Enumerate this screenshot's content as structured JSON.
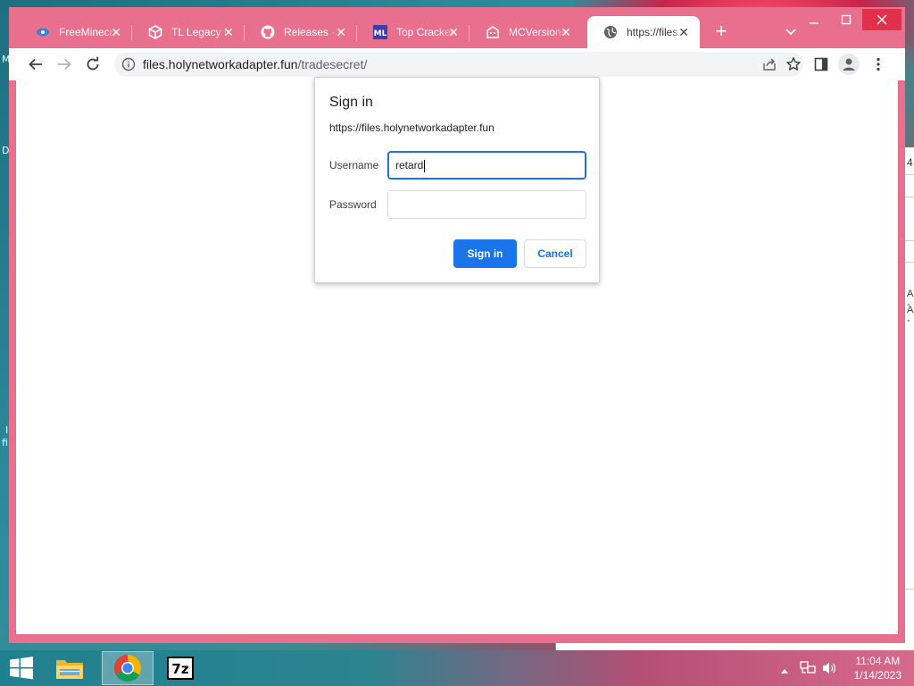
{
  "browser": {
    "tabs": [
      {
        "title": "FreeMinecraft",
        "icon": "freeminecraft-favicon-icon"
      },
      {
        "title": "TL Legacy for",
        "icon": "cube-favicon-icon"
      },
      {
        "title": "Releases · p",
        "icon": "github-favicon-icon"
      },
      {
        "title": "Top Cracked",
        "icon": "ml-favicon-icon"
      },
      {
        "title": "MCVersions",
        "icon": "mcversions-favicon-icon"
      },
      {
        "title": "https://files.",
        "icon": "globe-favicon-icon"
      }
    ],
    "active_tab": 5,
    "url_host": "files.holynetworkadapter.fun",
    "url_path": "/tradesecret/"
  },
  "dialog": {
    "title": "Sign in",
    "origin": "https://files.holynetworkadapter.fun",
    "username_label": "Username",
    "username_value": "retard",
    "password_label": "Password",
    "password_value": "",
    "signin_label": "Sign in",
    "cancel_label": "Cancel"
  },
  "desktop": {
    "left_glyphs": [
      "M",
      "D",
      "I",
      "fi"
    ],
    "right_glyphs": [
      "4",
      "A -",
      "A -"
    ]
  },
  "taskbar": {
    "time": "11:04 AM",
    "date": "1/14/2023",
    "apps": [
      "file-explorer-icon",
      "chrome-icon",
      "7zip-icon"
    ]
  },
  "colors": {
    "accent": "#1a73e8",
    "tabstrip": "#e8708e",
    "window_close": "#e1304c"
  }
}
